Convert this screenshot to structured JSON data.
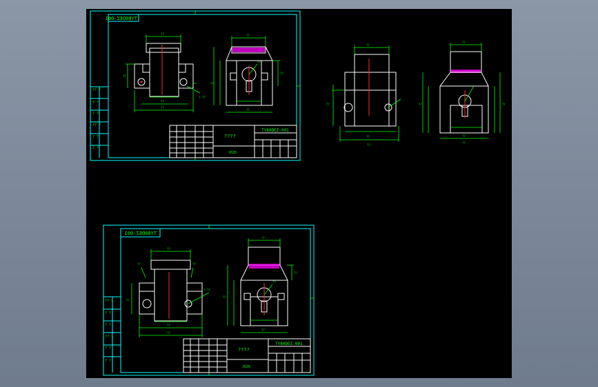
{
  "sheets": [
    {
      "drawing_no": "TY80DEZ-001",
      "mirrored_label": "TY80DEZ-001",
      "title_text": "????",
      "scale_text": "J6Z6"
    },
    {
      "drawing_no": "TY80DEZ-001",
      "mirrored_label": "TY80DEZ-001",
      "title_text": "????",
      "scale_text": "J6Z6"
    }
  ],
  "colors": {
    "background": "#000000",
    "frame": "#00ffff",
    "geometry": "#ffffff",
    "dimension": "#00ff00",
    "centerline": "#ff2a2a",
    "hatch": "#ff00ff"
  }
}
